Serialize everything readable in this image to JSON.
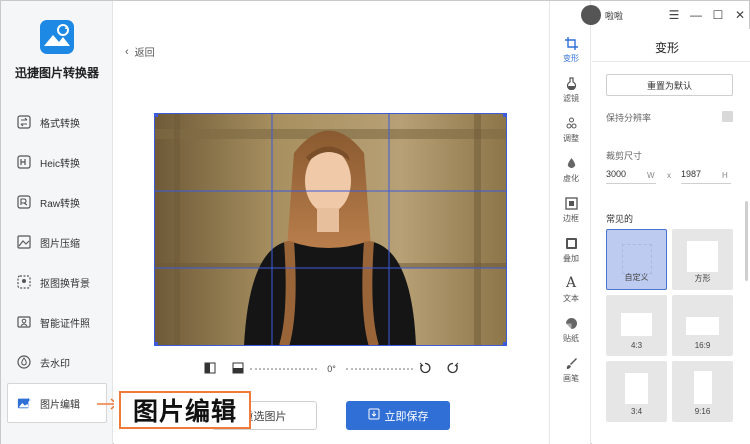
{
  "app": {
    "name": "迅捷图片转换器"
  },
  "nav": [
    {
      "label": "格式转换",
      "icon": "format-convert-icon"
    },
    {
      "label": "Heic转换",
      "icon": "heic-icon"
    },
    {
      "label": "Raw转换",
      "icon": "raw-icon"
    },
    {
      "label": "图片压缩",
      "icon": "compress-icon"
    },
    {
      "label": "抠图换背景",
      "icon": "cutout-icon"
    },
    {
      "label": "智能证件照",
      "icon": "id-photo-icon"
    },
    {
      "label": "去水印",
      "icon": "watermark-icon"
    },
    {
      "label": "图片编辑",
      "icon": "image-edit-icon",
      "active": true
    }
  ],
  "editor": {
    "back_label": "返回",
    "angle": "0°",
    "reselect_label": "重选图片",
    "save_label": "立即保存"
  },
  "callout": {
    "text": "图片编辑"
  },
  "tools": [
    {
      "label": "变形",
      "icon": "crop-icon",
      "active": true
    },
    {
      "label": "滤镜",
      "icon": "filter-icon"
    },
    {
      "label": "调整",
      "icon": "adjust-icon"
    },
    {
      "label": "虚化",
      "icon": "blur-icon"
    },
    {
      "label": "边框",
      "icon": "border-icon"
    },
    {
      "label": "叠加",
      "icon": "overlay-icon"
    },
    {
      "label": "文本",
      "icon": "text-icon"
    },
    {
      "label": "贴纸",
      "icon": "sticker-icon"
    },
    {
      "label": "画笔",
      "icon": "brush-icon"
    }
  ],
  "panel": {
    "title": "变形",
    "reset_label": "重置为默认",
    "keep_resolution_label": "保持分辨率",
    "crop_size_label": "裁剪尺寸",
    "width": "3000",
    "width_unit": "W",
    "times": "x",
    "height": "1987",
    "height_unit": "H",
    "common_label": "常见的",
    "presets": [
      {
        "label": "自定义",
        "selected": true
      },
      {
        "label": "方形"
      },
      {
        "label": "4:3"
      },
      {
        "label": "16:9"
      },
      {
        "label": "3:4"
      },
      {
        "label": "9:16"
      }
    ]
  },
  "titlebar": {
    "user": "啦啦"
  },
  "colors": {
    "accent": "#2f6fd6",
    "callout_border": "#f07a3a",
    "logo": "#1e88e5"
  }
}
